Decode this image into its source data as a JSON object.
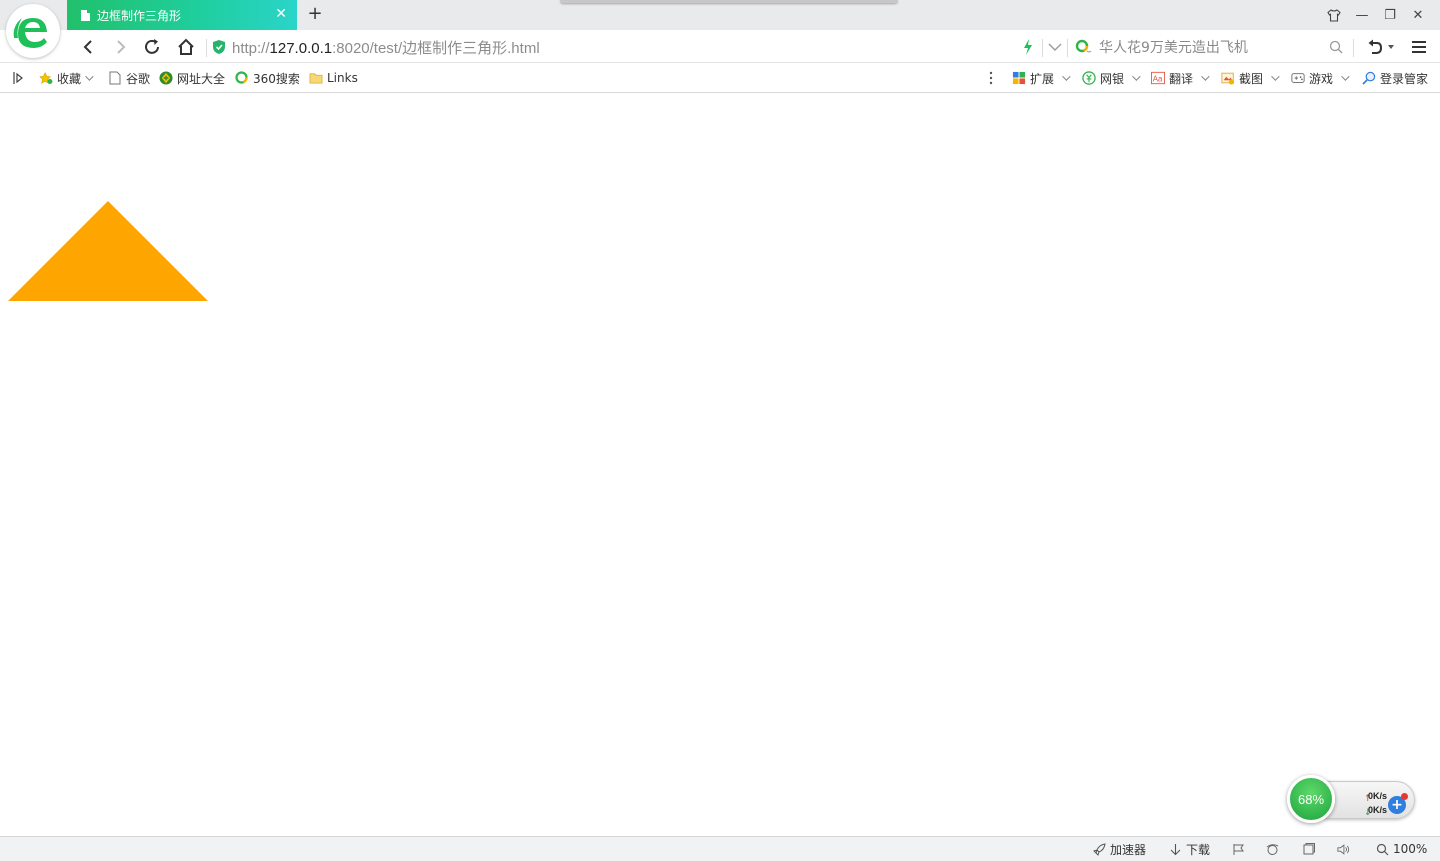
{
  "window": {
    "tab_title": "边框制作三角形",
    "new_tab_symbol": "+",
    "tab_close_symbol": "✕",
    "controls": {
      "skin": "skin-icon",
      "minimize": "—",
      "restore": "❐",
      "close": "✕"
    }
  },
  "navbar": {
    "url_prefix": "http://",
    "url_host": "127.0.0.1",
    "url_rest": ":8020/test/边框制作三角形.html",
    "search_text": "华人花9万美元造出飞机"
  },
  "bookmarks": {
    "left": [
      {
        "label": "收藏",
        "icon": "star-icon",
        "has_caret": true
      },
      {
        "label": "谷歌",
        "icon": "page-icon",
        "has_caret": false
      },
      {
        "label": "网址大全",
        "icon": "nav-site-icon",
        "has_caret": false
      },
      {
        "label": "360搜索",
        "icon": "360-search-icon",
        "has_caret": false
      },
      {
        "label": "Links",
        "icon": "folder-icon",
        "has_caret": false
      }
    ],
    "right": [
      {
        "label": "扩展",
        "icon": "extension-icon",
        "has_caret": true
      },
      {
        "label": "网银",
        "icon": "bank-icon",
        "has_caret": true
      },
      {
        "label": "翻译",
        "icon": "translate-icon",
        "has_caret": true
      },
      {
        "label": "截图",
        "icon": "screenshot-icon",
        "has_caret": true
      },
      {
        "label": "游戏",
        "icon": "game-icon",
        "has_caret": true
      },
      {
        "label": "登录管家",
        "icon": "login-manager-icon",
        "has_caret": false
      }
    ]
  },
  "content": {
    "triangle_color": "#ffa500"
  },
  "speed_widget": {
    "memory_percent": "68%",
    "upload": "0K/s",
    "download": "0K/s"
  },
  "statusbar": {
    "accelerator": "加速器",
    "download": "下载",
    "zoom": "100%"
  },
  "colors": {
    "tab_gradient_start": "#21c06b",
    "accent_green": "#1fbf5a",
    "shield_green": "#27b36b"
  }
}
